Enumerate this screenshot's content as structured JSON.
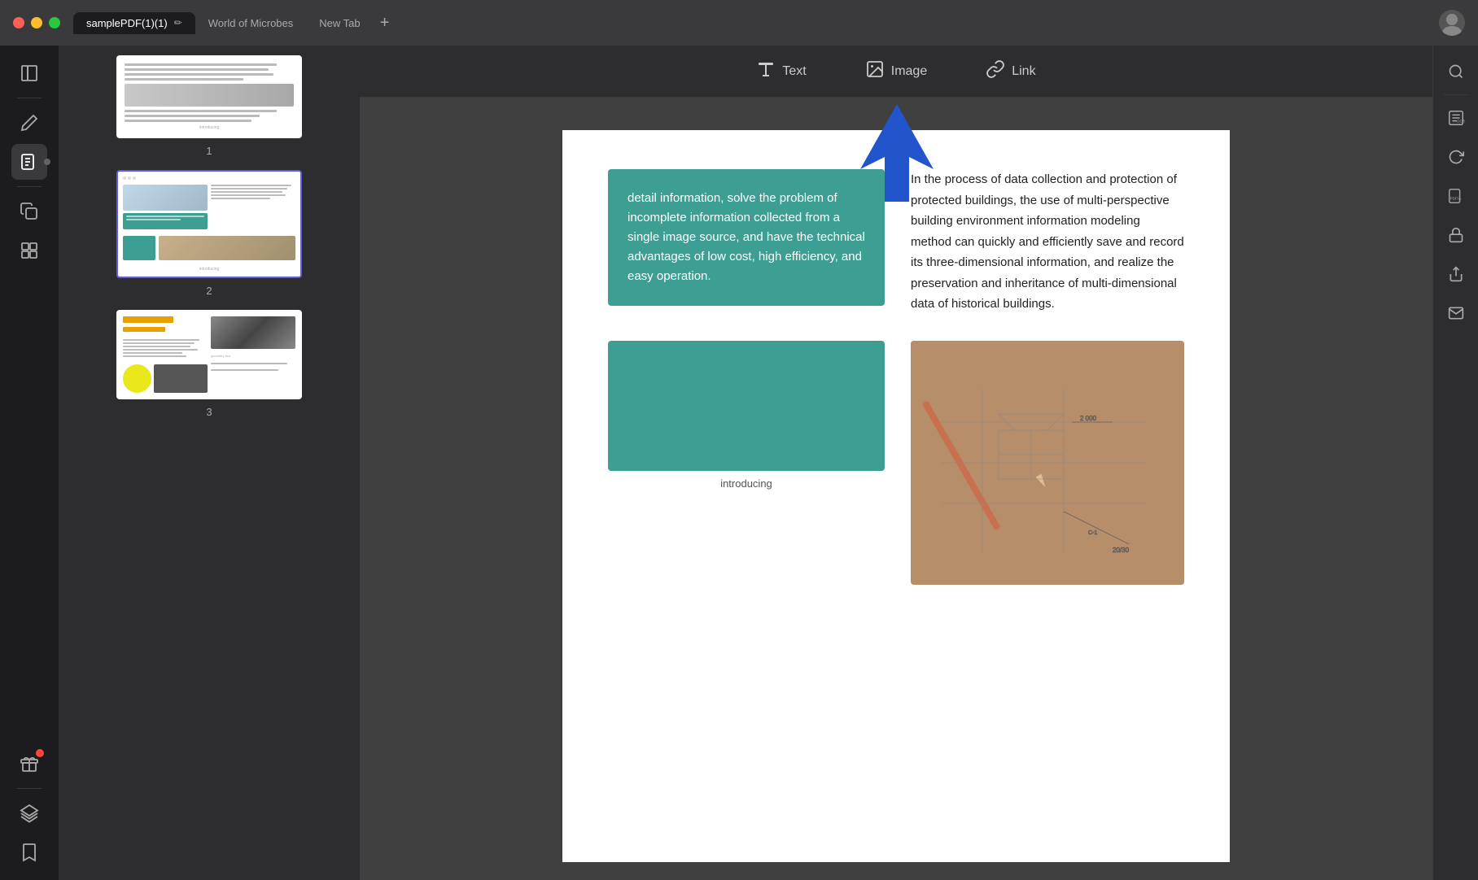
{
  "titlebar": {
    "tab_active": "samplePDF(1)(1)",
    "tab2": "World of Microbes",
    "tab3": "New Tab",
    "new_tab_btn": "+"
  },
  "toolbar": {
    "text_btn": "Text",
    "image_btn": "Image",
    "link_btn": "Link"
  },
  "thumbnails": [
    {
      "label": "1"
    },
    {
      "label": "2"
    },
    {
      "label": "3"
    }
  ],
  "pdf_content": {
    "teal_box_text": "detail information, solve the problem of incomplete information collected from a single image source, and have the technical advantages of low cost, high efficiency, and easy operation.",
    "info_text": "In the process of data collection and protection of protected buildings, the use of multi-perspective building environment information modeling method can quickly and efficiently save and record its three-dimensional information, and realize the preservation and inheritance of multi-dimensional data of historical buildings.",
    "introducing_label": "introducing"
  },
  "icons": {
    "search": "🔍",
    "ocr": "OCR",
    "refresh": "↻",
    "pdf_a": "PDF/A",
    "lock": "🔒",
    "share": "↑",
    "mail": "✉",
    "sidebar_book": "📖",
    "sidebar_pen": "✏",
    "sidebar_pages": "📋",
    "sidebar_copy": "⧉",
    "sidebar_layers": "⊞",
    "sidebar_bookmark": "🔖",
    "sidebar_gift": "🎁",
    "rt_search": "🔍",
    "rt_ocr": "OCR",
    "rt_refresh": "↻",
    "rt_lock": "🔒",
    "rt_share": "⬆",
    "rt_mail": "✉"
  }
}
